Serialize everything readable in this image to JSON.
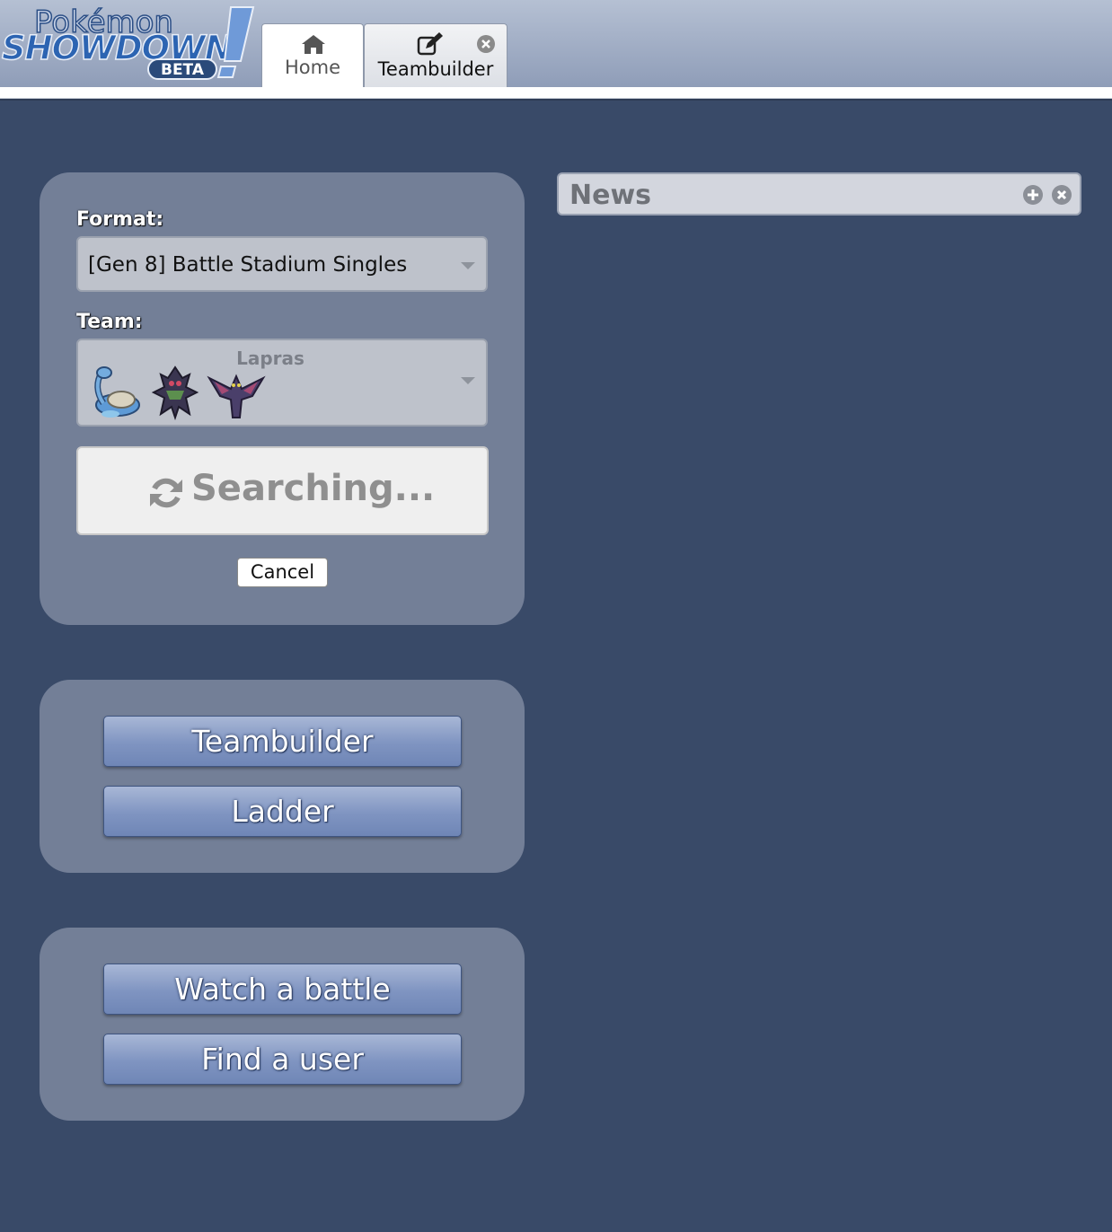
{
  "header": {
    "logo": {
      "line1": "Pokémon",
      "line2": "SHOWDOWN!",
      "badge": "BETA"
    },
    "tabs": [
      {
        "label": "Home",
        "icon": "home-icon"
      },
      {
        "label": "Teambuilder",
        "icon": "edit-icon",
        "closable": true
      }
    ]
  },
  "battle_panel": {
    "format_label": "Format:",
    "format_value": "[Gen 8] Battle Stadium Singles",
    "team_label": "Team:",
    "team_name": "Lapras",
    "team_sprites": [
      "lapras-sprite",
      "zarude-sprite",
      "noivern-sprite"
    ],
    "search_label": "Searching...",
    "search_icon": "refresh-icon",
    "cancel_label": "Cancel"
  },
  "menu_panel": {
    "teambuilder_label": "Teambuilder",
    "ladder_label": "Ladder"
  },
  "watch_panel": {
    "watch_label": "Watch a battle",
    "find_label": "Find a user"
  },
  "news": {
    "title": "News",
    "icons": [
      "plus-circle-icon",
      "close-circle-icon"
    ]
  },
  "colors": {
    "background": "#394a68",
    "panel": "#737f97",
    "button_blue": "#7f94c1"
  }
}
